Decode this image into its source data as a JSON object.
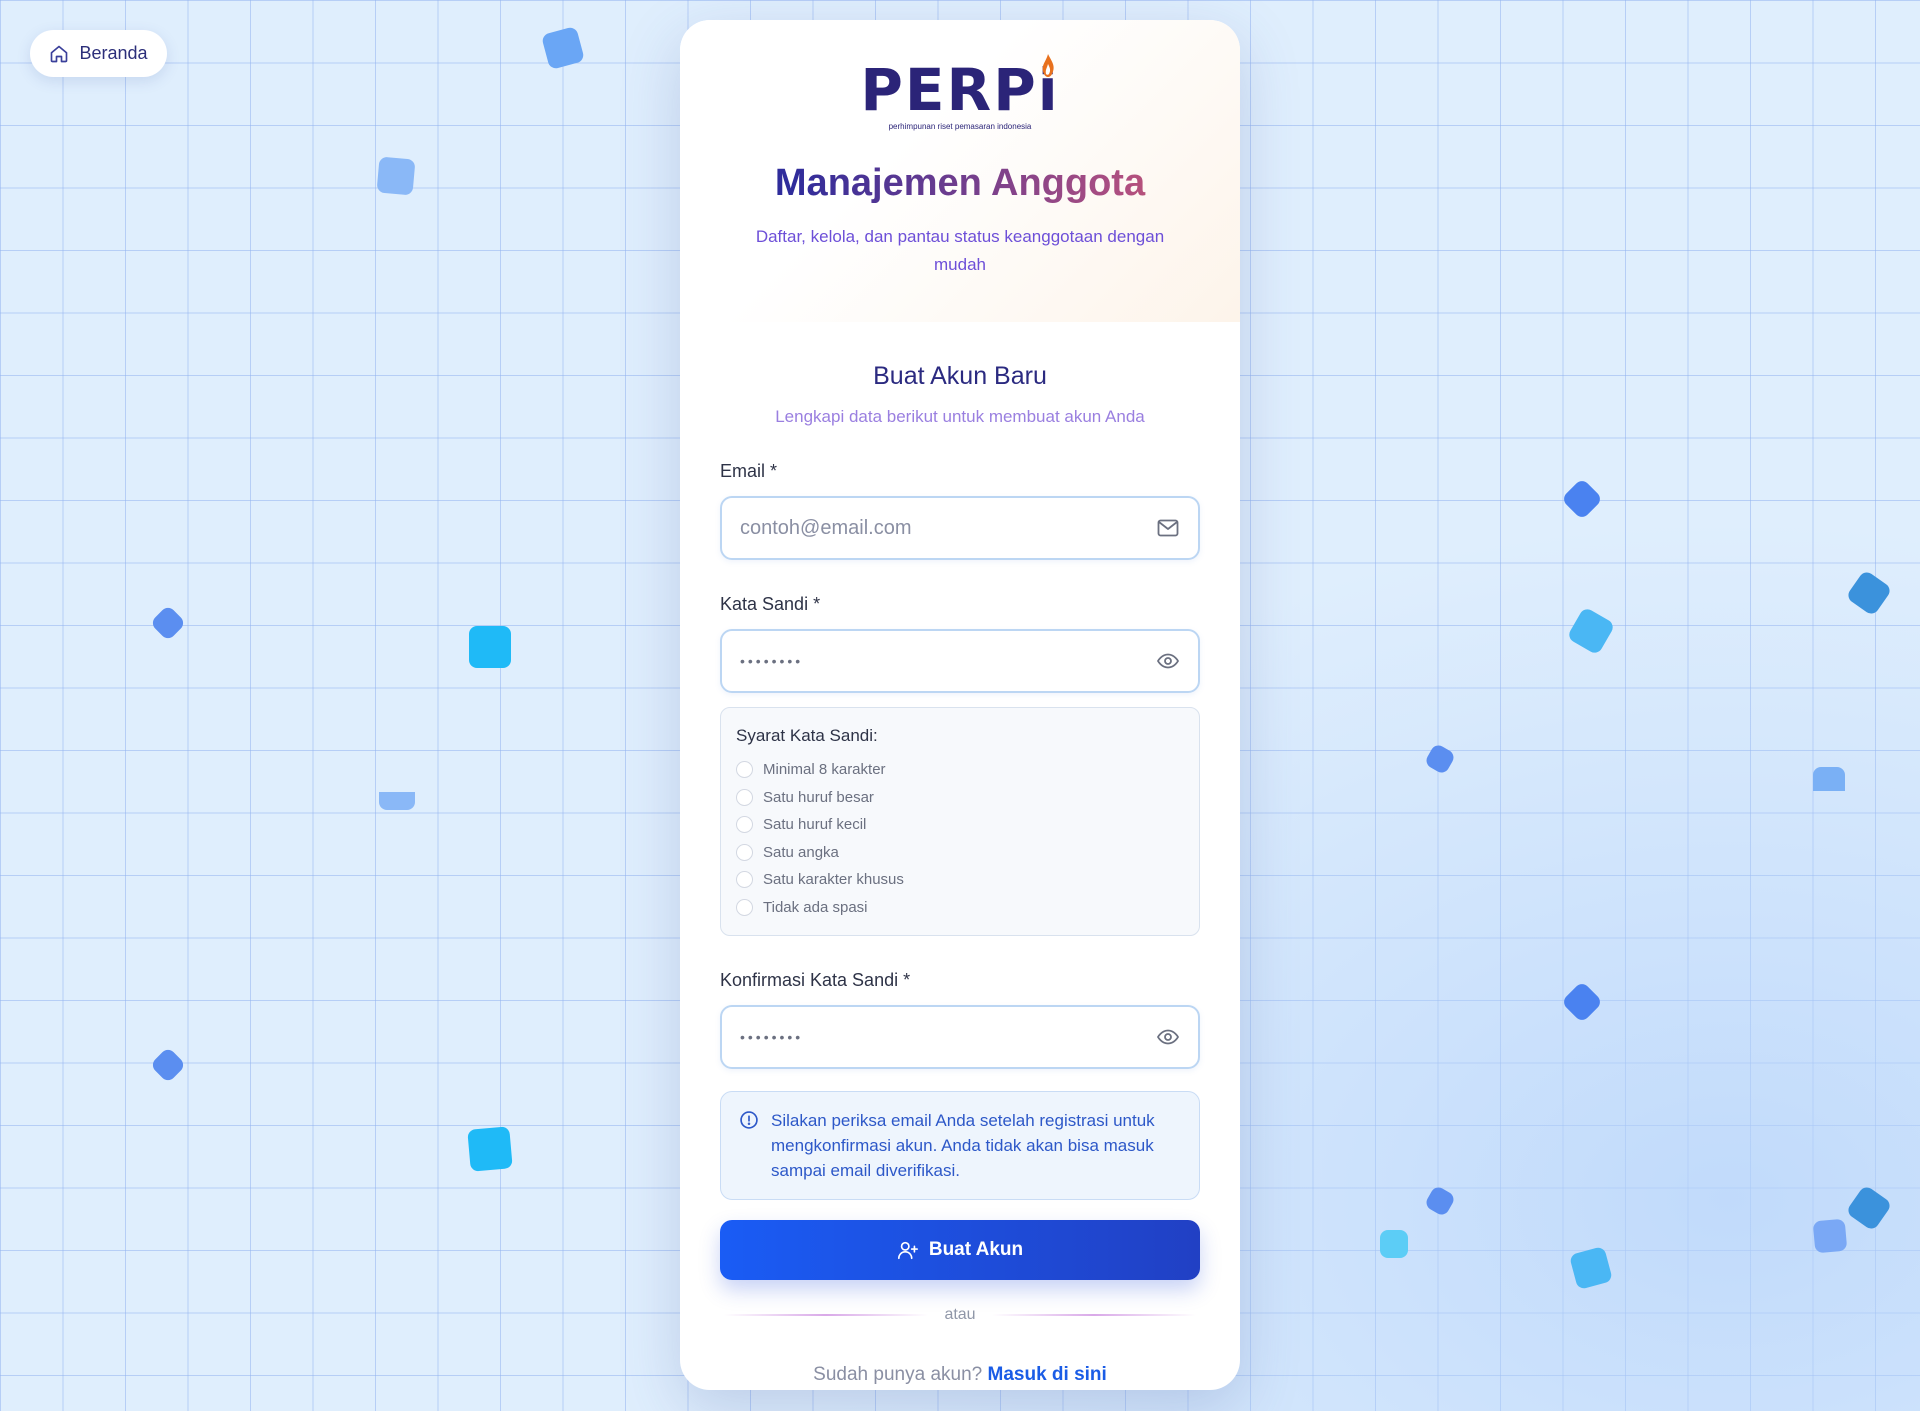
{
  "nav": {
    "home_label": "Beranda"
  },
  "brand": {
    "logo_text": "PERPi",
    "logo_tagline": "perhimpunan riset pemasaran indonesia"
  },
  "header": {
    "title": "Manajemen Anggota",
    "subtitle": "Daftar, kelola, dan pantau status keanggotaan dengan mudah"
  },
  "form": {
    "title": "Buat Akun Baru",
    "subtitle": "Lengkapi data berikut untuk membuat akun Anda",
    "email": {
      "label": "Email *",
      "placeholder": "contoh@email.com"
    },
    "password": {
      "label": "Kata Sandi *",
      "value": "••••••••"
    },
    "requirements": {
      "title": "Syarat Kata Sandi:",
      "items": [
        "Minimal 8 karakter",
        "Satu huruf besar",
        "Satu huruf kecil",
        "Satu angka",
        "Satu karakter khusus",
        "Tidak ada spasi"
      ]
    },
    "confirm_password": {
      "label": "Konfirmasi Kata Sandi *",
      "value": "••••••••"
    },
    "notice": "Silakan periksa email Anda setelah registrasi untuk mengkonfirmasi akun. Anda tidak akan bisa masuk sampai email diverifikasi.",
    "submit_label": "Buat Akun",
    "divider_text": "atau",
    "signin_prompt": "Sudah punya akun?",
    "signin_link": "Masuk di sini"
  },
  "colors": {
    "primary": "#1a5cf5",
    "brand_navy": "#2b2478",
    "accent_purple": "#6d4fd8",
    "flame_orange": "#e8711e"
  }
}
